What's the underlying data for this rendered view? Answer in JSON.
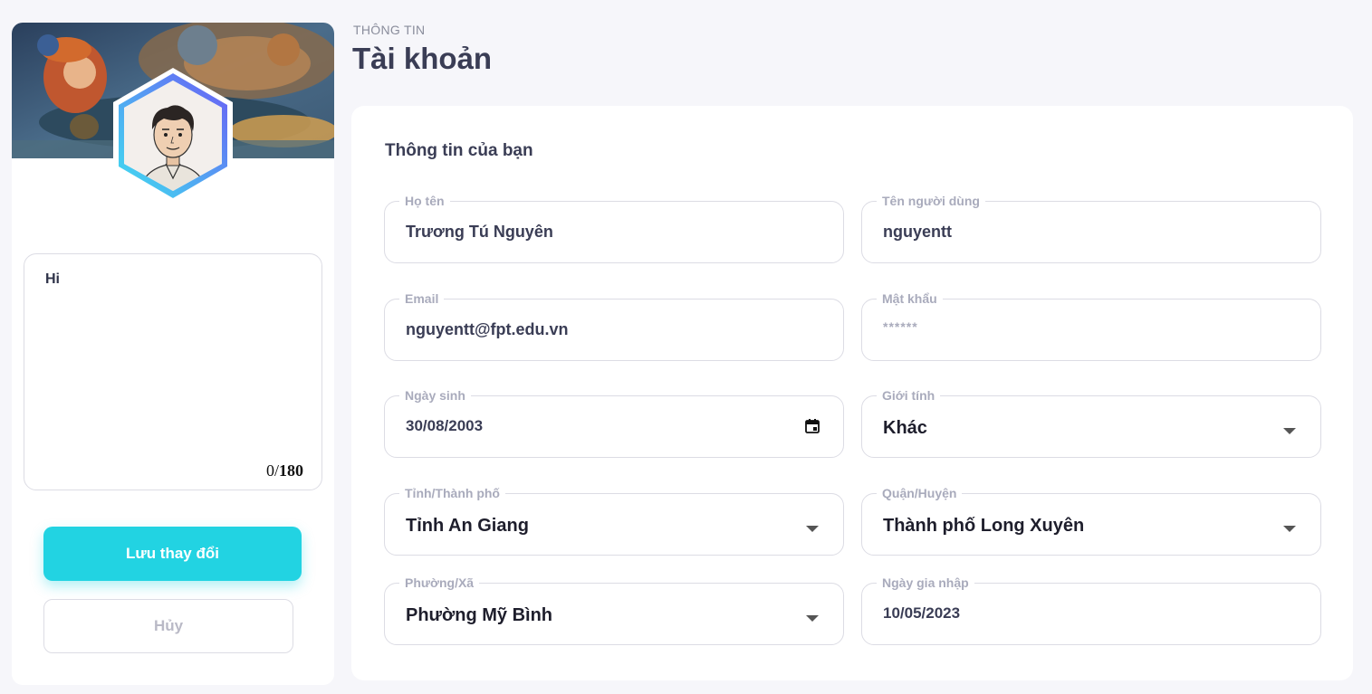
{
  "profile": {
    "bio_text": "Hi",
    "bio_count": "0",
    "bio_max": "180",
    "save_label": "Lưu thay đổi",
    "cancel_label": "Hủy"
  },
  "header": {
    "eyebrow": "THÔNG TIN",
    "title": "Tài khoản"
  },
  "form": {
    "section_title": "Thông tin của bạn",
    "fields": [
      {
        "label": "Họ tên",
        "value": "Trương Tú Nguyên"
      },
      {
        "label": "Tên người dùng",
        "value": "nguyentt"
      },
      {
        "label": "Email",
        "value": "nguyentt@fpt.edu.vn"
      },
      {
        "label": "Mật khẩu",
        "value": "******"
      },
      {
        "label": "Ngày sinh",
        "value": "30/08/2003"
      },
      {
        "label": "Giới tính",
        "value": "Khác"
      },
      {
        "label": "Tỉnh/Thành phố",
        "value": "Tỉnh An Giang"
      },
      {
        "label": "Quận/Huyện",
        "value": "Thành phố Long Xuyên"
      },
      {
        "label": "Phường/Xã",
        "value": "Phường Mỹ Bình"
      },
      {
        "label": "Ngày gia nhập",
        "value": "10/05/2023"
      }
    ]
  },
  "icons": {
    "calendar": "calendar-icon",
    "dropdown": "chevron-down-icon"
  },
  "colors": {
    "accent": "#22d3e2",
    "hex_gradient_start": "#3fe0f0",
    "hex_gradient_end": "#6b5cf5",
    "text_primary": "#3a3d55",
    "label": "#a9abbc"
  }
}
